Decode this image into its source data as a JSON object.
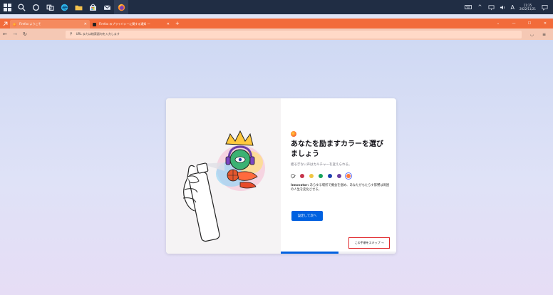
{
  "taskbar": {
    "ime_label": "A",
    "time": "11:25",
    "date": "2022/11/21"
  },
  "browser": {
    "tabs": [
      {
        "title": "Firefox ようこそ",
        "active": true
      },
      {
        "title": "Firefox のプライバシーに関する通知 — ",
        "active": false
      }
    ],
    "url_placeholder": "URL または検索語句を入力します"
  },
  "onboarding": {
    "title": "あなたを励ますカラーを選びましょう",
    "subtitle": "揺るぎない声はカルチャーを変えられる。",
    "swatch_colors": [
      "#c6344b",
      "#f0c541",
      "#14a35a",
      "#1e40af",
      "#6b3fa0",
      "#ff7a3d"
    ],
    "selected_swatch": 6,
    "desc_bold": "Innovator:",
    "desc_text": " あらゆる場所で機会を掴め、あなたがもたらす影響は周囲の人生を変化させる。",
    "primary_button": "設定して次へ",
    "skip_button": "この手順をスキップ →",
    "progress": 0.5
  }
}
